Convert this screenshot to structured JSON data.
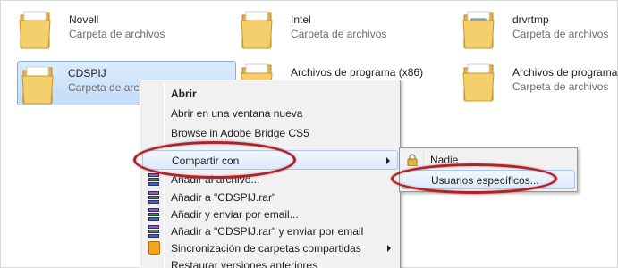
{
  "folders": [
    {
      "name": "Novell",
      "type": "Carpeta de archivos"
    },
    {
      "name": "Intel",
      "type": "Carpeta de archivos"
    },
    {
      "name": "drvrtmp",
      "type": "Carpeta de archivos"
    },
    {
      "name": "CDSPIJ",
      "type": "Carpeta de archi"
    },
    {
      "name": "Archivos de programa (x86)",
      "type": ""
    },
    {
      "name": "Archivos de programa",
      "type": "Carpeta de archivos"
    }
  ],
  "context_menu": {
    "items": [
      {
        "label": "Abrir"
      },
      {
        "label": "Abrir en una ventana nueva"
      },
      {
        "label": "Browse in Adobe Bridge CS5"
      },
      {
        "label": "Compartir con"
      },
      {
        "label": "Añadir al archivo..."
      },
      {
        "label": "Añadir a \"CDSPIJ.rar\""
      },
      {
        "label": "Añadir y enviar por email..."
      },
      {
        "label": "Añadir a \"CDSPIJ.rar\" y enviar por email"
      },
      {
        "label": "Sincronización de carpetas compartidas"
      },
      {
        "label": "Restaurar versiones anteriores"
      }
    ]
  },
  "submenu": {
    "items": [
      {
        "label": "Nadie"
      },
      {
        "label": "Usuarios específicos..."
      }
    ]
  },
  "colors": {
    "highlight_oval": "#b4202a",
    "selection": "#c4dcf7",
    "menu_bg": "#f1f1f1"
  },
  "icons": {
    "folder": "folder-icon",
    "rar": "winrar-icon",
    "sync": "sync-icon",
    "lock": "lock-icon"
  }
}
